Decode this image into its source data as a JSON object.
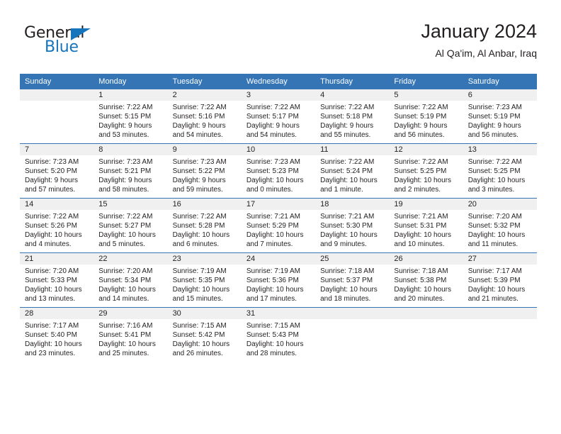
{
  "brand": {
    "name_dark": "General",
    "name_blue": "Blue",
    "accent_color": "#1574bb"
  },
  "header": {
    "title": "January 2024",
    "subtitle": "Al Qa'im, Al Anbar, Iraq"
  },
  "theme": {
    "header_blue": "#3575b6",
    "daynum_band": "#f0f0f0",
    "text": "#231f20"
  },
  "weekday_headers": [
    "Sunday",
    "Monday",
    "Tuesday",
    "Wednesday",
    "Thursday",
    "Friday",
    "Saturday"
  ],
  "weeks": [
    [
      {
        "day": "",
        "lines": []
      },
      {
        "day": "1",
        "lines": [
          "Sunrise: 7:22 AM",
          "Sunset: 5:15 PM",
          "Daylight: 9 hours",
          "and 53 minutes."
        ]
      },
      {
        "day": "2",
        "lines": [
          "Sunrise: 7:22 AM",
          "Sunset: 5:16 PM",
          "Daylight: 9 hours",
          "and 54 minutes."
        ]
      },
      {
        "day": "3",
        "lines": [
          "Sunrise: 7:22 AM",
          "Sunset: 5:17 PM",
          "Daylight: 9 hours",
          "and 54 minutes."
        ]
      },
      {
        "day": "4",
        "lines": [
          "Sunrise: 7:22 AM",
          "Sunset: 5:18 PM",
          "Daylight: 9 hours",
          "and 55 minutes."
        ]
      },
      {
        "day": "5",
        "lines": [
          "Sunrise: 7:22 AM",
          "Sunset: 5:19 PM",
          "Daylight: 9 hours",
          "and 56 minutes."
        ]
      },
      {
        "day": "6",
        "lines": [
          "Sunrise: 7:23 AM",
          "Sunset: 5:19 PM",
          "Daylight: 9 hours",
          "and 56 minutes."
        ]
      }
    ],
    [
      {
        "day": "7",
        "lines": [
          "Sunrise: 7:23 AM",
          "Sunset: 5:20 PM",
          "Daylight: 9 hours",
          "and 57 minutes."
        ]
      },
      {
        "day": "8",
        "lines": [
          "Sunrise: 7:23 AM",
          "Sunset: 5:21 PM",
          "Daylight: 9 hours",
          "and 58 minutes."
        ]
      },
      {
        "day": "9",
        "lines": [
          "Sunrise: 7:23 AM",
          "Sunset: 5:22 PM",
          "Daylight: 9 hours",
          "and 59 minutes."
        ]
      },
      {
        "day": "10",
        "lines": [
          "Sunrise: 7:23 AM",
          "Sunset: 5:23 PM",
          "Daylight: 10 hours",
          "and 0 minutes."
        ]
      },
      {
        "day": "11",
        "lines": [
          "Sunrise: 7:22 AM",
          "Sunset: 5:24 PM",
          "Daylight: 10 hours",
          "and 1 minute."
        ]
      },
      {
        "day": "12",
        "lines": [
          "Sunrise: 7:22 AM",
          "Sunset: 5:25 PM",
          "Daylight: 10 hours",
          "and 2 minutes."
        ]
      },
      {
        "day": "13",
        "lines": [
          "Sunrise: 7:22 AM",
          "Sunset: 5:25 PM",
          "Daylight: 10 hours",
          "and 3 minutes."
        ]
      }
    ],
    [
      {
        "day": "14",
        "lines": [
          "Sunrise: 7:22 AM",
          "Sunset: 5:26 PM",
          "Daylight: 10 hours",
          "and 4 minutes."
        ]
      },
      {
        "day": "15",
        "lines": [
          "Sunrise: 7:22 AM",
          "Sunset: 5:27 PM",
          "Daylight: 10 hours",
          "and 5 minutes."
        ]
      },
      {
        "day": "16",
        "lines": [
          "Sunrise: 7:22 AM",
          "Sunset: 5:28 PM",
          "Daylight: 10 hours",
          "and 6 minutes."
        ]
      },
      {
        "day": "17",
        "lines": [
          "Sunrise: 7:21 AM",
          "Sunset: 5:29 PM",
          "Daylight: 10 hours",
          "and 7 minutes."
        ]
      },
      {
        "day": "18",
        "lines": [
          "Sunrise: 7:21 AM",
          "Sunset: 5:30 PM",
          "Daylight: 10 hours",
          "and 9 minutes."
        ]
      },
      {
        "day": "19",
        "lines": [
          "Sunrise: 7:21 AM",
          "Sunset: 5:31 PM",
          "Daylight: 10 hours",
          "and 10 minutes."
        ]
      },
      {
        "day": "20",
        "lines": [
          "Sunrise: 7:20 AM",
          "Sunset: 5:32 PM",
          "Daylight: 10 hours",
          "and 11 minutes."
        ]
      }
    ],
    [
      {
        "day": "21",
        "lines": [
          "Sunrise: 7:20 AM",
          "Sunset: 5:33 PM",
          "Daylight: 10 hours",
          "and 13 minutes."
        ]
      },
      {
        "day": "22",
        "lines": [
          "Sunrise: 7:20 AM",
          "Sunset: 5:34 PM",
          "Daylight: 10 hours",
          "and 14 minutes."
        ]
      },
      {
        "day": "23",
        "lines": [
          "Sunrise: 7:19 AM",
          "Sunset: 5:35 PM",
          "Daylight: 10 hours",
          "and 15 minutes."
        ]
      },
      {
        "day": "24",
        "lines": [
          "Sunrise: 7:19 AM",
          "Sunset: 5:36 PM",
          "Daylight: 10 hours",
          "and 17 minutes."
        ]
      },
      {
        "day": "25",
        "lines": [
          "Sunrise: 7:18 AM",
          "Sunset: 5:37 PM",
          "Daylight: 10 hours",
          "and 18 minutes."
        ]
      },
      {
        "day": "26",
        "lines": [
          "Sunrise: 7:18 AM",
          "Sunset: 5:38 PM",
          "Daylight: 10 hours",
          "and 20 minutes."
        ]
      },
      {
        "day": "27",
        "lines": [
          "Sunrise: 7:17 AM",
          "Sunset: 5:39 PM",
          "Daylight: 10 hours",
          "and 21 minutes."
        ]
      }
    ],
    [
      {
        "day": "28",
        "lines": [
          "Sunrise: 7:17 AM",
          "Sunset: 5:40 PM",
          "Daylight: 10 hours",
          "and 23 minutes."
        ]
      },
      {
        "day": "29",
        "lines": [
          "Sunrise: 7:16 AM",
          "Sunset: 5:41 PM",
          "Daylight: 10 hours",
          "and 25 minutes."
        ]
      },
      {
        "day": "30",
        "lines": [
          "Sunrise: 7:15 AM",
          "Sunset: 5:42 PM",
          "Daylight: 10 hours",
          "and 26 minutes."
        ]
      },
      {
        "day": "31",
        "lines": [
          "Sunrise: 7:15 AM",
          "Sunset: 5:43 PM",
          "Daylight: 10 hours",
          "and 28 minutes."
        ]
      },
      {
        "day": "",
        "lines": []
      },
      {
        "day": "",
        "lines": []
      },
      {
        "day": "",
        "lines": []
      }
    ]
  ]
}
